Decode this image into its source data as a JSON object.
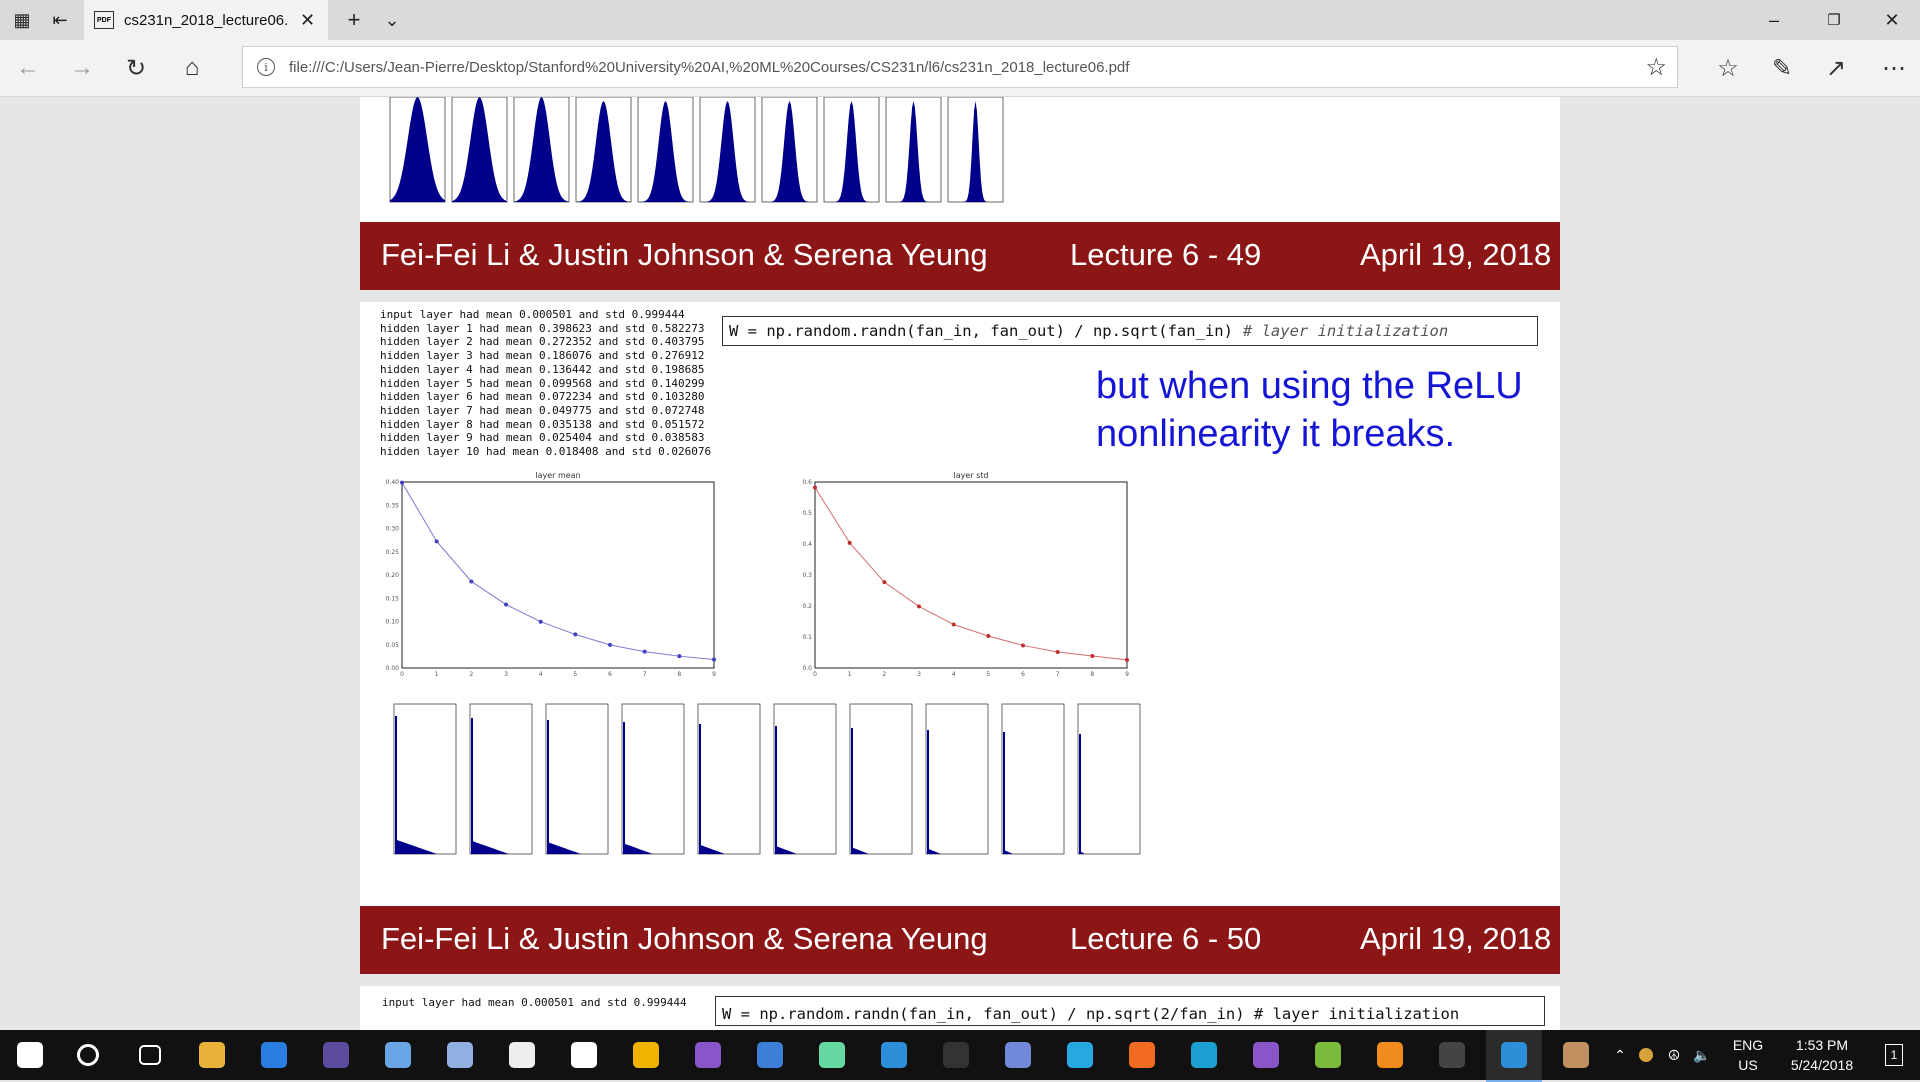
{
  "tab": {
    "title": "cs231n_2018_lecture06.",
    "pdf_icon": "PDF"
  },
  "address": {
    "url": "file:///C:/Users/Jean-Pierre/Desktop/Stanford%20University%20AI,%20ML%20Courses/CS231n/l6/cs231n_2018_lecture06.pdf"
  },
  "slide49": {
    "footer_names": "Fei-Fei Li & Justin Johnson & Serena Yeung",
    "footer_lecture": "Lecture 6 - 49",
    "footer_date": "April 19, 2018"
  },
  "slide50": {
    "stats": [
      "input layer had mean 0.000501 and std 0.999444",
      "hidden layer 1 had mean 0.398623 and std 0.582273",
      "hidden layer 2 had mean 0.272352 and std 0.403795",
      "hidden layer 3 had mean 0.186076 and std 0.276912",
      "hidden layer 4 had mean 0.136442 and std 0.198685",
      "hidden layer 5 had mean 0.099568 and std 0.140299",
      "hidden layer 6 had mean 0.072234 and std 0.103280",
      "hidden layer 7 had mean 0.049775 and std 0.072748",
      "hidden layer 8 had mean 0.035138 and std 0.051572",
      "hidden layer 9 had mean 0.025404 and std 0.038583",
      "hidden layer 10 had mean 0.018408 and std 0.026076"
    ],
    "code": "W = np.random.randn(fan_in, fan_out) / np.sqrt(fan_in)",
    "code_comment": "# layer initialization",
    "note_line1": "but when using the ReLU",
    "note_line2": "nonlinearity it breaks.",
    "footer_names": "Fei-Fei Li & Justin Johnson & Serena Yeung",
    "footer_lecture": "Lecture 6 - 50",
    "footer_date": "April 19, 2018"
  },
  "slide51": {
    "stats_first": "input layer had mean 0.000501 and std 0.999444",
    "code": "W = np.random.randn(fan_in, fan_out) / np.sqrt(2/fan_in) # layer initialization"
  },
  "chart_data": [
    {
      "type": "line",
      "title": "layer mean",
      "x": [
        0,
        1,
        2,
        3,
        4,
        5,
        6,
        7,
        8,
        9
      ],
      "values": [
        0.398623,
        0.272352,
        0.186076,
        0.136442,
        0.099568,
        0.072234,
        0.049775,
        0.035138,
        0.025404,
        0.018408
      ],
      "ylim": [
        0,
        0.4
      ],
      "yticks": [
        "0.00",
        "0.05",
        "0.10",
        "0.15",
        "0.20",
        "0.25",
        "0.30",
        "0.35",
        "0.40"
      ],
      "color": "#4040c0"
    },
    {
      "type": "line",
      "title": "layer std",
      "x": [
        0,
        1,
        2,
        3,
        4,
        5,
        6,
        7,
        8,
        9
      ],
      "values": [
        0.582273,
        0.403795,
        0.276912,
        0.198685,
        0.140299,
        0.10328,
        0.072748,
        0.051572,
        0.038583,
        0.026076
      ],
      "ylim": [
        0,
        0.6
      ],
      "yticks": [
        "0.0",
        "0.1",
        "0.2",
        "0.3",
        "0.4",
        "0.5",
        "0.6"
      ],
      "color": "#c03030"
    }
  ],
  "taskbar": {
    "lang1": "ENG",
    "lang2": "US",
    "time": "1:53 PM",
    "date": "5/24/2018",
    "notif": "1"
  },
  "icons": [
    "windows-start-icon",
    "search-circle-icon",
    "task-view-icon",
    "file-explorer-icon",
    "store-icon",
    "eclipse-icon",
    "box-icon",
    "box-icon-2",
    "obs-icon",
    "sticky-icon",
    "chrome-icon",
    "visual-studio-icon",
    "notepad-icon",
    "atom-icon",
    "vscode-icon",
    "terminal-icon",
    "discord-icon",
    "docker-icon",
    "origin-icon",
    "jetbrains-icon",
    "vs2-icon",
    "gimp-icon",
    "vlc-icon",
    "console-icon",
    "edge-icon",
    "paint-icon"
  ],
  "accent": {
    "footer": "#8c1515",
    "note": "#1515d6",
    "hist": "#00008b"
  }
}
